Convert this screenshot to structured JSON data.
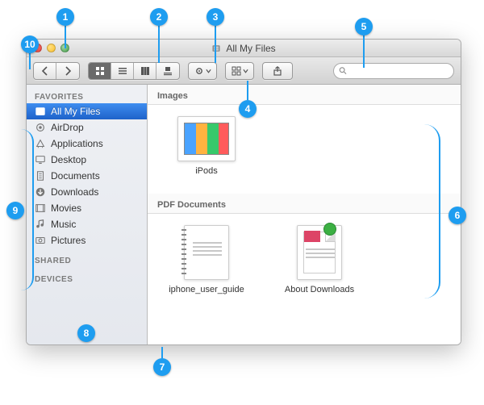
{
  "window": {
    "title": "All My Files"
  },
  "sidebar": {
    "sections": {
      "favorites": "FAVORITES",
      "shared": "SHARED",
      "devices": "DEVICES"
    },
    "items": [
      {
        "label": "All My Files"
      },
      {
        "label": "AirDrop"
      },
      {
        "label": "Applications"
      },
      {
        "label": "Desktop"
      },
      {
        "label": "Documents"
      },
      {
        "label": "Downloads"
      },
      {
        "label": "Movies"
      },
      {
        "label": "Music"
      },
      {
        "label": "Pictures"
      }
    ]
  },
  "content": {
    "groups": [
      {
        "header": "Images",
        "files": [
          {
            "name": "iPods"
          }
        ]
      },
      {
        "header": "PDF Documents",
        "files": [
          {
            "name": "iphone_user_guide"
          },
          {
            "name": "About Downloads"
          }
        ]
      }
    ]
  },
  "callouts": {
    "c1": "1",
    "c2": "2",
    "c3": "3",
    "c4": "4",
    "c5": "5",
    "c6": "6",
    "c7": "7",
    "c8": "8",
    "c9": "9",
    "c10": "10"
  }
}
